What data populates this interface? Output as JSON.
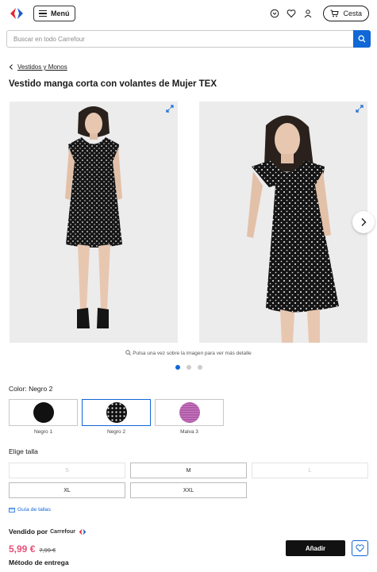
{
  "header": {
    "menu_label": "Menú",
    "cart_label": "Cesta"
  },
  "search": {
    "placeholder": "Buscar en todo Carrefour"
  },
  "breadcrumb": {
    "label": "Vestidos y Monos"
  },
  "product": {
    "title": "Vestido manga corta con volantes de Mujer TEX",
    "image_hint": "Pulsa una vez sobre la imagen para ver más detalle",
    "color_prefix": "Color:",
    "selected_color": "Negro 2",
    "colors": [
      {
        "name": "Negro 1",
        "color": "#111111"
      },
      {
        "name": "Negro 2",
        "color": "#111111"
      },
      {
        "name": "Malva 3",
        "color": "#b05aa8"
      }
    ],
    "size_label": "Elige talla",
    "sizes": [
      {
        "label": "S",
        "available": false
      },
      {
        "label": "M",
        "available": true
      },
      {
        "label": "L",
        "available": false
      },
      {
        "label": "XL",
        "available": true
      },
      {
        "label": "XXL",
        "available": true
      }
    ],
    "size_guide": "Guía de tallas",
    "sold_by_label": "Vendido por",
    "sold_by_brand": "Carrefour",
    "price": "5,99 €",
    "old_price": "7,99 €",
    "add_label": "Añadir",
    "delivery_label": "Método de entrega"
  },
  "colors": {
    "accent": "#1067d6",
    "price": "#e6507a",
    "brand_blue": "#1e5bc6",
    "brand_red": "#e3262e"
  }
}
